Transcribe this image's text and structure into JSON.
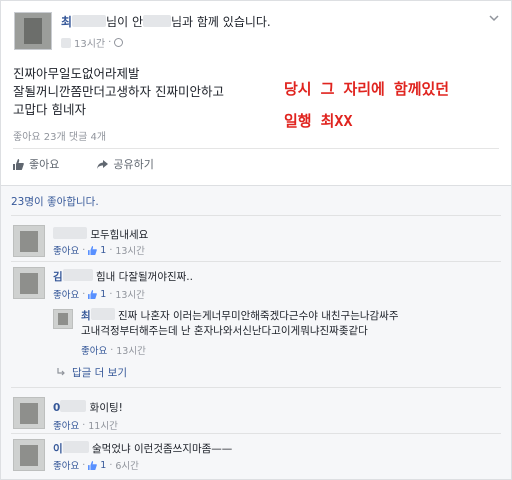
{
  "post": {
    "author_visible": "최",
    "header_mid": "님이 안",
    "header_tail": "님과 함께 있습니다.",
    "time": "13시간",
    "body_lines": [
      "진짜아무일도없어라제발",
      "잘될꺼니깐쫌만더고생하자 진짜미안하고",
      "고맙다 힘네자"
    ],
    "stats": "좋아요 23개  댓글 4개"
  },
  "annotation": {
    "line1": "당시 그 자리에 함께있던",
    "line2": "일행 최XX",
    "color": "#e0241f"
  },
  "actions": {
    "like": "좋아요",
    "share": "공유하기"
  },
  "liked_by": "23명이 좋아합니다.",
  "comments": [
    {
      "name": "",
      "text": "모두힘내세요",
      "like": "좋아요",
      "count": "1",
      "time": "13시간"
    },
    {
      "name": "김",
      "text": "힘내 다잘될꺼야진짜..",
      "like": "좋아요",
      "count": "1",
      "time": "13시간"
    },
    {
      "name": "최",
      "text_line1": "진짜 나혼자 이러는게너무미안해죽겠다근수야 내친구는나감싸주",
      "text_line2": "고내걱정부터해주는데 난 혼자나와서신난다고이게뭐냐진짜좆같다",
      "like": "좋아요",
      "time": "13시간"
    },
    {
      "name": "0",
      "text": "화이팅!",
      "like": "좋아요",
      "time": "11시간"
    },
    {
      "name": "이",
      "text": "술먹었냐 이런것좀쓰지마좀——",
      "like": "좋아요",
      "count": "1",
      "time": "6시간"
    }
  ],
  "more_replies": "답글 더 보기",
  "colors": {
    "link": "#365899",
    "muted": "#90949c",
    "band": "#f6f7f9"
  },
  "icons": [
    "globe-icon",
    "chevron-down-icon",
    "like-icon",
    "share-icon",
    "reply-arrow-icon",
    "thumb-icon"
  ]
}
